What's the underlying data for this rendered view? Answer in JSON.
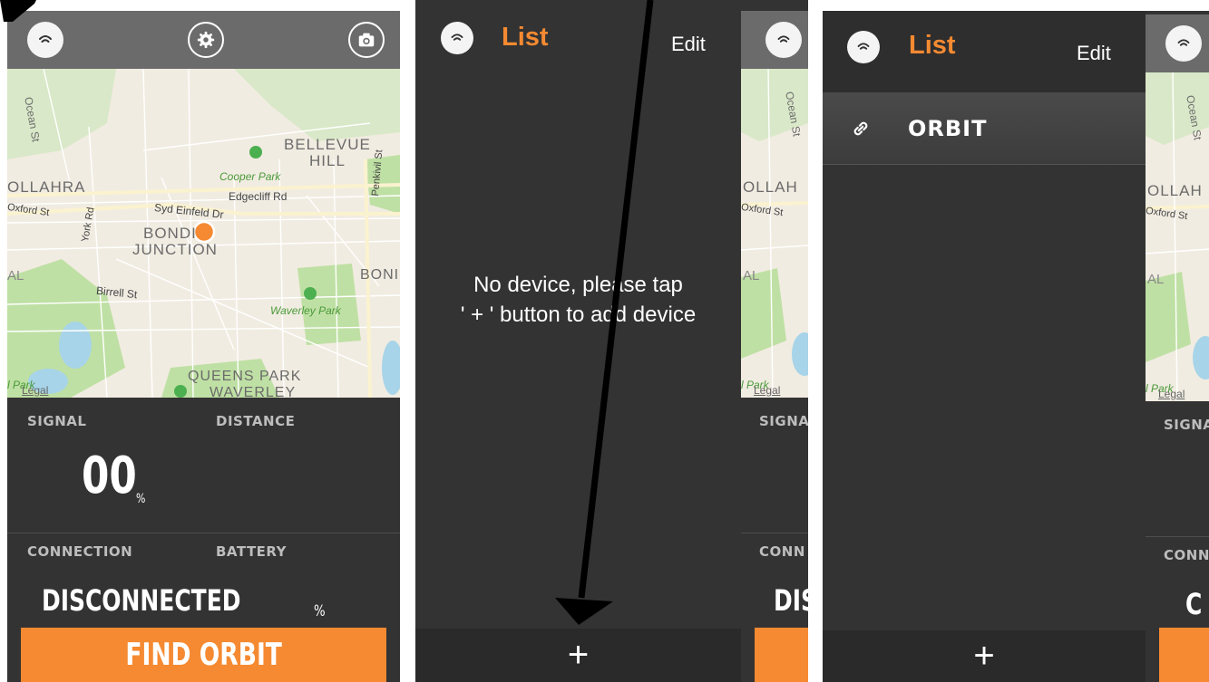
{
  "main_screen": {
    "stats": {
      "signal_label": "SIGNAL",
      "distance_label": "DISTANCE",
      "signal_value": "00",
      "signal_unit": "%",
      "connection_label": "CONNECTION",
      "battery_label": "BATTERY",
      "connection_value": "DISCONNECTED",
      "battery_unit": "%"
    },
    "find_button_label": "FIND ORBIT",
    "map": {
      "labels": {
        "ocean_st": "Ocean St",
        "bellevue": "BELLEVUE",
        "hill": "HILL",
        "cooper_park": "Cooper Park",
        "woollahra": "OLLAHRA",
        "edgecliff_rd": "Edgecliff Rd",
        "oxford_st": "Oxford St",
        "syd_einfeld_dr": "Syd Einfeld Dr",
        "bondi": "BONDI",
        "junction": "JUNCTION",
        "york_rd": "York Rd",
        "penkivil_st": "Penkivil St",
        "bondi_right": "BONI",
        "al": "AL",
        "birrell_st": "Birrell St",
        "waverley_park": "Waverley Park",
        "queens_park": "QUEENS PARK",
        "waverley": "WAVERLEY",
        "park_left": "l Park",
        "legal": "Legal"
      }
    }
  },
  "empty_list_screen": {
    "title": "List",
    "edit_label": "Edit",
    "empty_message_line1": "No device, please tap",
    "empty_message_line2": "' + ' button to add device",
    "add_label": "+"
  },
  "device_list_screen": {
    "title": "List",
    "edit_label": "Edit",
    "devices": [
      {
        "name": "ORBIT"
      }
    ],
    "add_label": "+"
  },
  "partial_main_screens": {
    "labels": {
      "woollahra": "OLLAH",
      "oxford_st": "Oxford St",
      "al": "AL",
      "park": "l Park",
      "legal": "Legal",
      "ocean_st": "Ocean St",
      "signal": "SIGNA",
      "connection": "CONN",
      "connection_value_first": "DISC",
      "connection_value_second": "C"
    }
  },
  "colors": {
    "accent": "#f58a32",
    "panel_bg": "#333333",
    "topbar_bg": "#6b6b6b",
    "map_bg": "#f1ece1",
    "park_green": "#bfe0a4",
    "water_blue": "#a7d4e8"
  },
  "icons": {
    "signal": "signal-icon",
    "settings": "gear-icon",
    "camera": "camera-icon",
    "link": "link-icon",
    "location_dot": "location-dot-icon",
    "park_marker": "park-marker-icon"
  }
}
